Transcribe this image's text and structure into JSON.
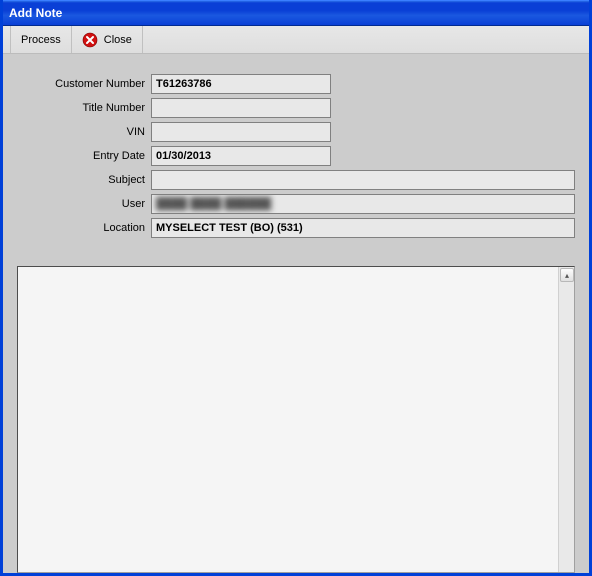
{
  "window": {
    "title": "Add Note"
  },
  "toolbar": {
    "process_label": "Process",
    "close_label": "Close"
  },
  "form": {
    "customer_number": {
      "label": "Customer Number",
      "value": "T61263786"
    },
    "title_number": {
      "label": "Title Number",
      "value": ""
    },
    "vin": {
      "label": "VIN",
      "value": ""
    },
    "entry_date": {
      "label": "Entry Date",
      "value": "01/30/2013"
    },
    "subject": {
      "label": "Subject",
      "value": ""
    },
    "user": {
      "label": "User",
      "value": "████ ████ ██████"
    },
    "location": {
      "label": "Location",
      "value": "MYSELECT TEST (BO) (531)"
    }
  },
  "note_body": ""
}
